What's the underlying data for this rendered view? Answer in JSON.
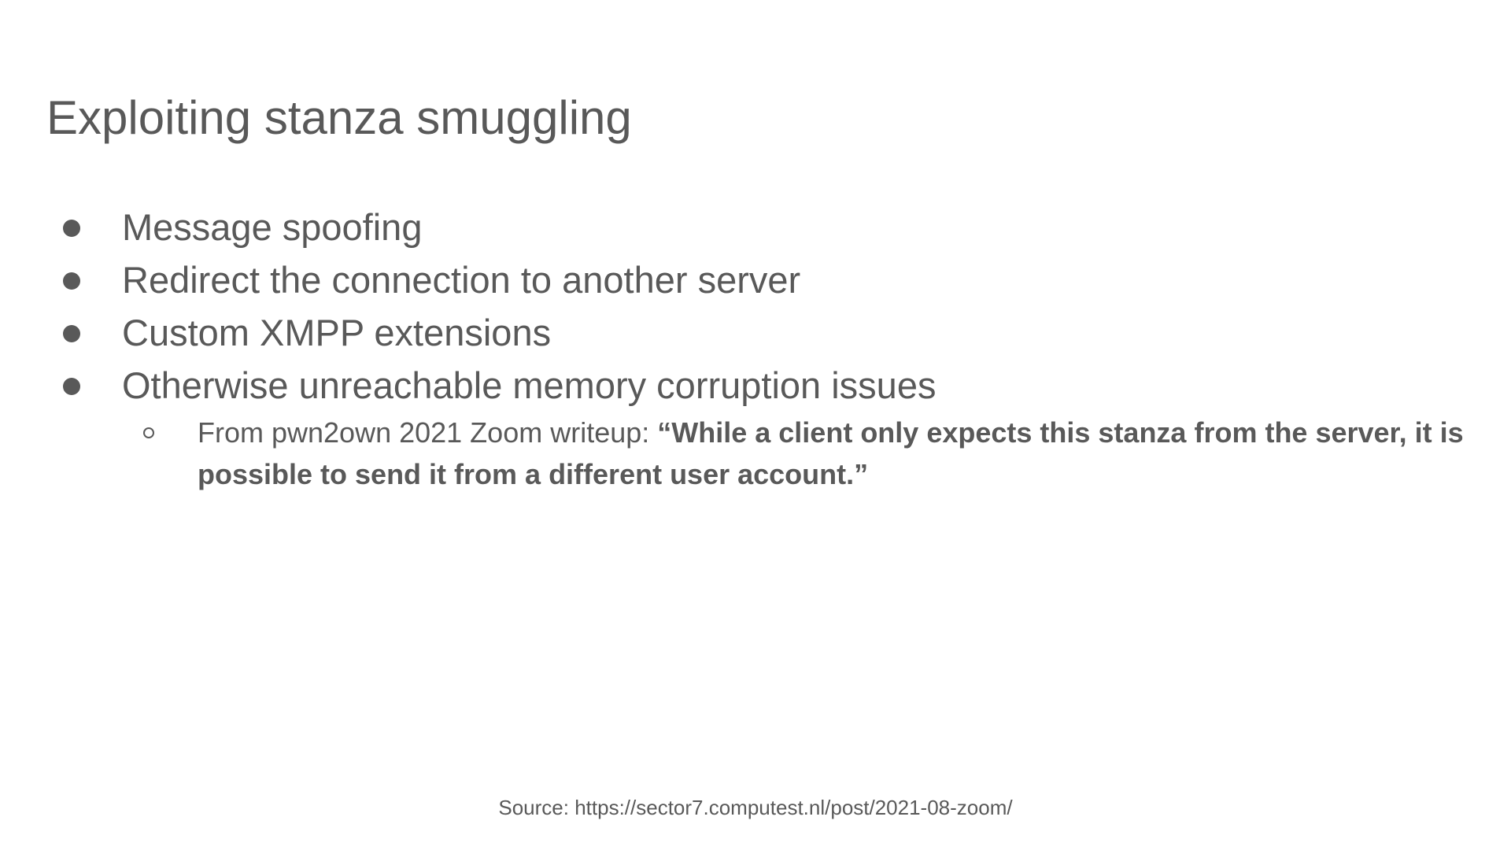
{
  "slide": {
    "title": "Exploiting stanza smuggling",
    "bullets": [
      {
        "text": "Message spoofing"
      },
      {
        "text": "Redirect the connection to another server"
      },
      {
        "text": "Custom XMPP extensions"
      },
      {
        "text": "Otherwise unreachable memory corruption issues"
      }
    ],
    "sub_bullet": {
      "prefix": "From pwn2own 2021 Zoom writeup: ",
      "quote": "“While a client only expects this stanza from the server, it is possible to send it from a different user account.”"
    },
    "source": "Source: https://sector7.computest.nl/post/2021-08-zoom/"
  },
  "colors": {
    "text": "#595959",
    "background": "#ffffff"
  }
}
